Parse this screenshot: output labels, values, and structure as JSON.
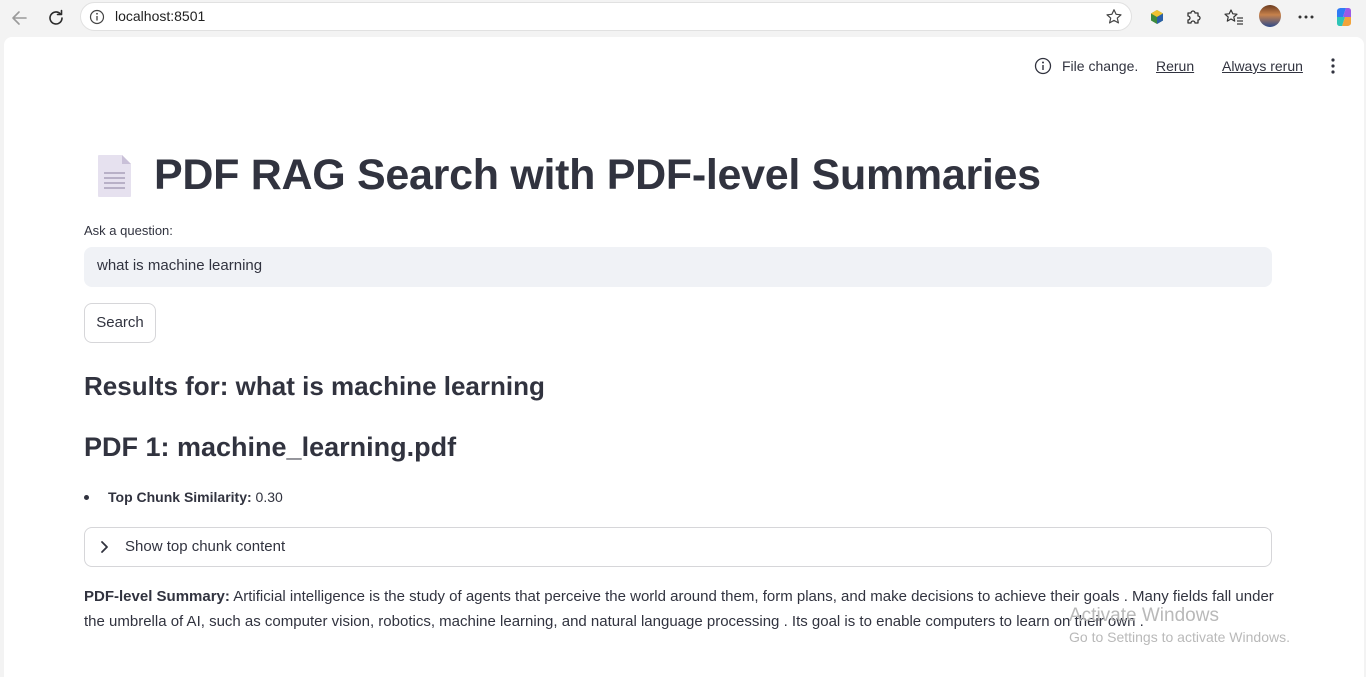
{
  "browser": {
    "url": "localhost:8501"
  },
  "toolbar": {
    "status": "File change.",
    "rerun_label": "Rerun",
    "always_rerun_label": "Always rerun"
  },
  "main": {
    "title": "PDF RAG Search with PDF-level Summaries",
    "question_label": "Ask a question:",
    "question_value": "what is machine learning",
    "search_label": "Search",
    "results_heading": "Results for: what is machine learning",
    "pdf_heading": "PDF 1: machine_learning.pdf",
    "similarity_label": "Top Chunk Similarity:",
    "similarity_value": "0.30",
    "expander_label": "Show top chunk content",
    "summary_label": "PDF-level Summary:",
    "summary_text": "Artificial intelligence is the study of agents that perceive the world around them, form plans, and make decisions to achieve their goals . Many fields fall under the umbrella of AI, such as computer vision, robotics, machine learning, and natural language processing . Its goal is to enable computers to learn on their own ."
  },
  "watermark": {
    "title": "Activate Windows",
    "subtitle": "Go to Settings to activate Windows."
  },
  "icons": {
    "back": "back-arrow-icon",
    "reload": "reload-icon",
    "info": "info-icon",
    "favorite": "star-icon",
    "extensions": "puzzle-icon",
    "favorites": "favorites-icon",
    "more": "more-icon",
    "copilot": "copilot-icon",
    "document": "document-icon",
    "chevron": "chevron-right-icon",
    "kebab": "kebab-menu-icon"
  }
}
